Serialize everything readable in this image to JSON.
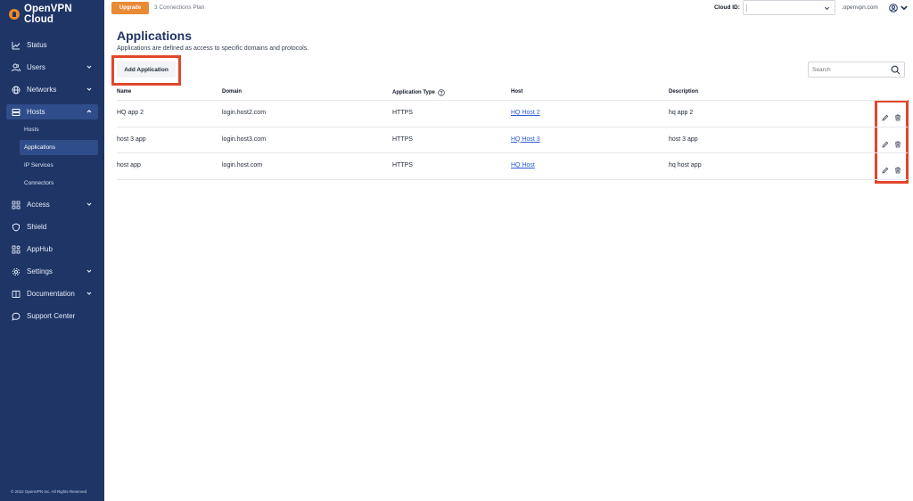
{
  "brand": {
    "name": "OpenVPN Cloud"
  },
  "sidebar": {
    "items": [
      {
        "label": "Status",
        "icon": "chart-icon",
        "chevron": false
      },
      {
        "label": "Users",
        "icon": "users-icon",
        "chevron": true
      },
      {
        "label": "Networks",
        "icon": "globe-icon",
        "chevron": true
      },
      {
        "label": "Hosts",
        "icon": "server-icon",
        "chevron": true,
        "active": true,
        "children": [
          "Hosts",
          "Applications",
          "IP Services",
          "Connectors"
        ]
      },
      {
        "label": "Access",
        "icon": "grid-icon",
        "chevron": true
      },
      {
        "label": "Shield",
        "icon": "shield-icon",
        "chevron": false
      },
      {
        "label": "AppHub",
        "icon": "apps-icon",
        "chevron": false
      },
      {
        "label": "Settings",
        "icon": "gear-icon",
        "chevron": true
      },
      {
        "label": "Documentation",
        "icon": "book-icon",
        "chevron": true
      },
      {
        "label": "Support Center",
        "icon": "chat-icon",
        "chevron": false
      }
    ],
    "selected_child": "Applications",
    "footer": "© 2022 OpenVPN Inc. All Rights Reserved"
  },
  "topbar": {
    "upgrade_label": "Upgrade",
    "plan": "3 Connections Plan",
    "cloud_id_label": "Cloud ID:",
    "cloud_domain": ".openvpn.com"
  },
  "page": {
    "title": "Applications",
    "subtitle": "Applications are defined as access to specific domains and protocols.",
    "add_label": "Add Application",
    "search_placeholder": "Search"
  },
  "table": {
    "columns": {
      "name": "Name",
      "domain": "Domain",
      "type": "Application Type",
      "host": "Host",
      "description": "Description"
    },
    "rows": [
      {
        "name": "HQ app 2",
        "domain": "login.host2.com",
        "type": "HTTPS",
        "host": "HQ Host 2",
        "description": "hq app 2"
      },
      {
        "name": "host 3 app",
        "domain": "login.host3.com",
        "type": "HTTPS",
        "host": "HQ Host 3",
        "description": "host 3 app"
      },
      {
        "name": "host app",
        "domain": "login.host.com",
        "type": "HTTPS",
        "host": "HQ Host",
        "description": "hq host app"
      }
    ]
  },
  "colors": {
    "sidebar": "#1f3566",
    "accent": "#e98a35",
    "highlight": "#e2462b",
    "link": "#2a5bd7"
  }
}
